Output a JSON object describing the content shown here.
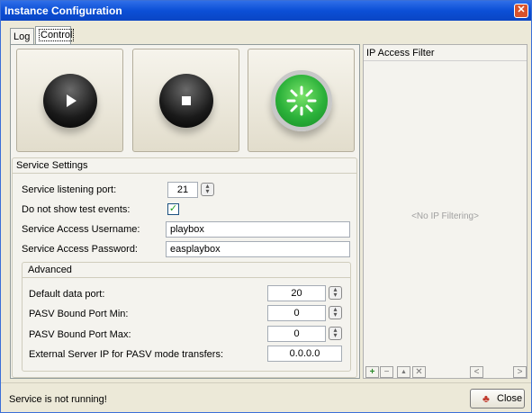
{
  "window": {
    "title": "Instance Configuration",
    "close_glyph": "✕"
  },
  "tabs": [
    {
      "label": "Log"
    },
    {
      "label": "Control"
    }
  ],
  "controls": {
    "play": "play-icon",
    "stop": "stop-icon",
    "running": "loading-icon"
  },
  "service_settings": {
    "title": "Service Settings",
    "port_label": "Service listening port:",
    "port_value": "21",
    "test_events_label": "Do not show test events:",
    "test_events_checked": true,
    "username_label": "Service Access Username:",
    "username_value": "playbox",
    "password_label": "Service Access Password:",
    "password_value": "easplaybox"
  },
  "advanced": {
    "title": "Advanced",
    "data_port_label": "Default data port:",
    "data_port_value": "20",
    "pasv_min_label": "PASV Bound Port Min:",
    "pasv_min_value": "0",
    "pasv_max_label": "PASV Bound Port Max:",
    "pasv_max_value": "0",
    "ext_ip_label": "External Server IP for PASV mode transfers:",
    "ext_ip_value": "0.0.0.0"
  },
  "ip_filter": {
    "title": "IP Access Filter",
    "empty_text": "<No IP Filtering>",
    "toolbar": {
      "add": "+",
      "remove": "−",
      "up": "▲",
      "delete": "✕",
      "left": "<",
      "right": ">"
    }
  },
  "status": {
    "text": "Service is not running!"
  },
  "close_button": {
    "label": "Close"
  }
}
